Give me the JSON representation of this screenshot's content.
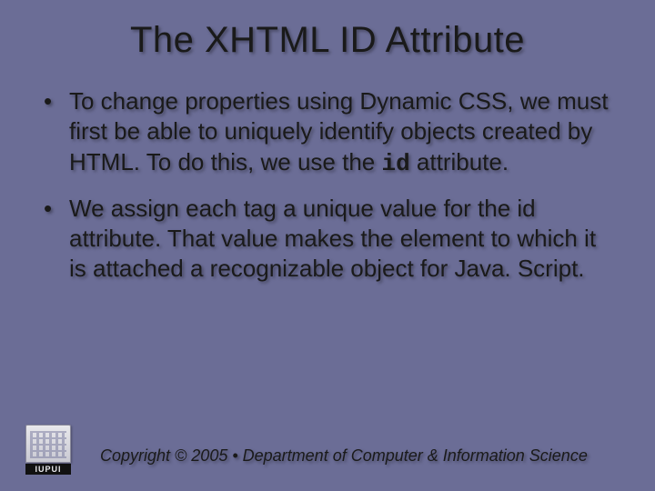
{
  "title": "The XHTML ID Attribute",
  "bullets": [
    {
      "pre": "To change properties using Dynamic CSS, we must first be able to uniquely identify objects created by HTML. To do this, we use the ",
      "code": "id",
      "post": " attribute."
    },
    {
      "pre": "We assign each tag a unique value for the id attribute. That value makes the element to which it is attached a recognizable object for Java. Script.",
      "code": "",
      "post": ""
    }
  ],
  "logo_text": "IUPUI",
  "copyright": "Copyright © 2005 • Department of Computer & Information Science"
}
